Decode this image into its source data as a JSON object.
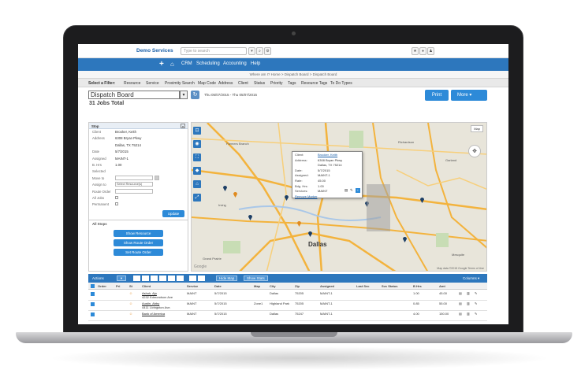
{
  "app": {
    "brand": "Demo Services",
    "search_placeholder": "Type to search"
  },
  "nav": {
    "items": [
      "CRM",
      "Scheduling",
      "Accounting",
      "Help"
    ]
  },
  "breadcrumb": "Where am I? Home > Dispatch Board > Dispatch Board",
  "filter": {
    "label": "Select a Filter:",
    "items": [
      "Resource",
      "Service",
      "Proximity Search",
      "Map Code",
      "Address",
      "Client",
      "Status",
      "Priority",
      "Tags",
      "Resource Tags",
      "To Do Types"
    ]
  },
  "board": {
    "title": "Dispatch Board",
    "date_range": "Thu 05/07/2015 - Thu 05/07/2015",
    "jobs_total": "31 Jobs Total",
    "print_label": "Print",
    "more_label": "More"
  },
  "panel": {
    "header": "Stop",
    "client_label": "Client",
    "client_value": "Brooker, Keith",
    "address_label": "Address",
    "address_line1": "6308 Bryan Pkwy",
    "address_line2": "Dallas, TX 75214",
    "date_label": "Date",
    "date_value": "5/7/2015",
    "assigned_label": "Assigned",
    "assigned_value": "MAINT-1",
    "hrs_label": "B. Hrs",
    "hrs_value": "1.00",
    "selected_label": "Selected",
    "move_to_label": "Move to",
    "assign_to_label": "Assign to",
    "assign_to_value": "Select Resource(s)",
    "route_order_label": "Route Order",
    "all_jobs_label": "All Jobs",
    "permanent_label": "Permanent",
    "update_label": "Update",
    "all_stops_label": "All Stops",
    "btn_show_resource": "Show Resource",
    "btn_show_route": "Show Route Order",
    "btn_set_route": "Set Route Order"
  },
  "map": {
    "city": "Dallas",
    "labels": [
      "Farmers Branch",
      "Richardson",
      "Garland",
      "Irving",
      "Mesquite",
      "Grand Prairie"
    ],
    "type_label": "Map",
    "footer": "Map data ©2015 Google  Terms of Use",
    "google": "Google",
    "popup": {
      "client_label": "Client:",
      "client_value": "Brooker, Keith",
      "address_label": "Address:",
      "address_line1": "6308 Bryan Pkwy",
      "address_line2": "Dallas, TX 75214",
      "date_label": "Date:",
      "date_value": "5/7/2015",
      "assigned_label": "Assigned:",
      "assigned_value": "MAINT-1",
      "rate_label": "Rate:",
      "rate_value": "45.00",
      "bhrs_label": "Bdg. Hrs:",
      "bhrs_value": "1.00",
      "services_label": "Services:",
      "services_value": "MAINT",
      "remove_marker": "Remove Marker"
    }
  },
  "actions": {
    "label": "Actions",
    "hide_map": "Hide Map",
    "show_stats": "Show Stats",
    "columns": "Columns"
  },
  "table": {
    "headers": [
      "Order",
      "Pri",
      "St",
      "Client",
      "Service",
      "Date",
      "Map",
      "City",
      "Zip",
      "Assigned",
      "Last Svc",
      "Svc Status",
      "B Hrs",
      "Amt"
    ],
    "rows": [
      {
        "client": "Ashok, Ajo",
        "address": "4232 Edmondson Ave",
        "service": "MAINT",
        "date": "5/7/2015",
        "zone": "",
        "city": "Dallas",
        "zip": "75205",
        "assigned": "MAINT-1",
        "bhrs": "1.00",
        "amt": "45.00"
      },
      {
        "client": "Austin, Abby",
        "address": "4411 Livingston Ave.",
        "service": "MAINT",
        "date": "5/7/2015",
        "zone": "Zone1",
        "city": "Highland Park",
        "zip": "75205",
        "assigned": "MAINT-1",
        "bhrs": "0.85",
        "amt": "55.00"
      },
      {
        "client": "Bank of America",
        "address": "",
        "service": "MAINT",
        "date": "5/7/2015",
        "zone": "",
        "city": "Dallas",
        "zip": "75247",
        "assigned": "MAINT-1",
        "bhrs": "4.00",
        "amt": "150.00"
      }
    ]
  },
  "colors": {
    "nav_blue": "#2d77bd",
    "button_blue": "#2d8ad8",
    "map_road": "#f3b33d"
  }
}
